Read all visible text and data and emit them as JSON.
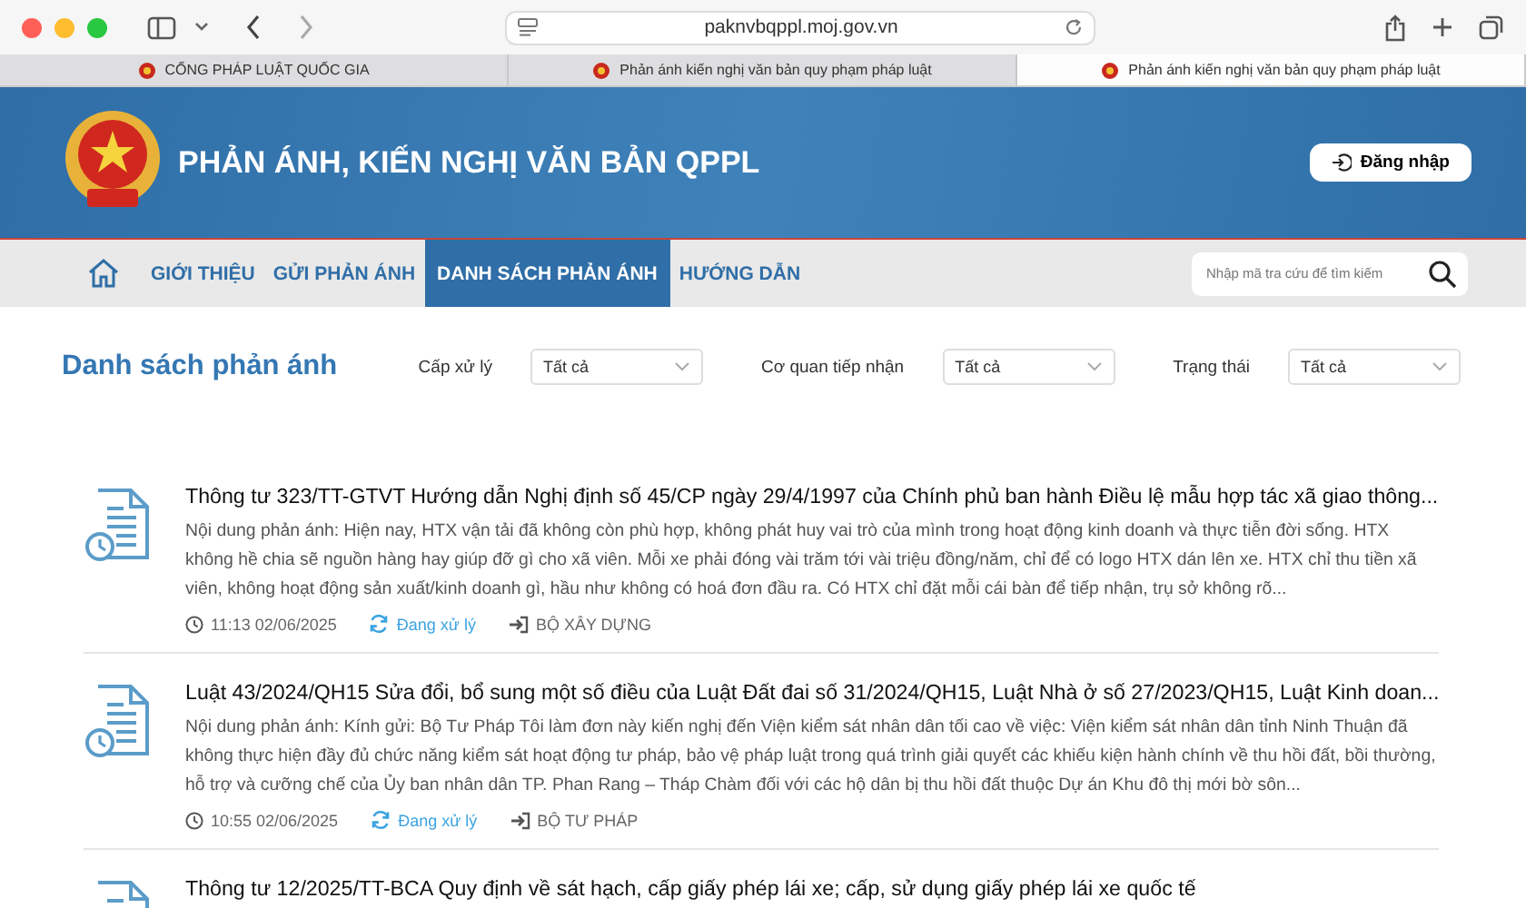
{
  "browser": {
    "url": "paknvbqppl.moj.gov.vn",
    "tabs": [
      {
        "title": "CỔNG PHÁP LUẬT QUỐC GIA",
        "selected": false
      },
      {
        "title": "Phản ánh kiến nghị văn bản quy phạm pháp luật",
        "selected": false
      },
      {
        "title": "Phản ánh kiến nghị văn bản quy phạm pháp luật",
        "selected": true
      }
    ]
  },
  "header": {
    "title": "PHẢN ÁNH, KIẾN NGHỊ VĂN BẢN QPPL",
    "login_button": "Đăng nhập"
  },
  "nav": {
    "items": [
      {
        "label": "GIỚI THIỆU",
        "selected": false
      },
      {
        "label": "GỬI PHẢN ÁNH",
        "selected": false
      },
      {
        "label": "DANH SÁCH PHẢN ÁNH",
        "selected": true
      },
      {
        "label": "HƯỚNG DẪN",
        "selected": false
      }
    ],
    "search": {
      "placeholder": "Nhập mã tra cứu để tìm kiếm"
    }
  },
  "page_title": "Danh sách phản ánh",
  "filters": [
    {
      "label": "Cấp xử lý",
      "value": "Tất cả"
    },
    {
      "label": "Cơ quan tiếp nhận",
      "value": "Tất cả"
    },
    {
      "label": "Trạng thái",
      "value": "Tất cả"
    }
  ],
  "items": [
    {
      "title": "Thông tư 323/TT-GTVT Hướng dẫn Nghị định số 45/CP ngày 29/4/1997 của Chính phủ ban hành Điều lệ mẫu hợp tác xã giao thông...",
      "content": "Nội dung phản ánh: Hiện nay, HTX vận tải đã không còn phù hợp, không phát huy vai trò của mình trong hoạt động kinh doanh và thực tiễn đời sống. HTX không hề chia sẽ nguồn hàng hay giúp đỡ gì cho xã viên. Mỗi xe phải đóng vài trăm tới vài triệu đồng/năm, chỉ để có logo HTX dán lên xe. HTX chỉ thu tiền xã viên, không hoạt động sản xuất/kinh doanh gì, hầu như không có hoá đơn đầu ra. Có HTX chỉ đặt mỗi cái bàn để tiếp nhận, trụ sở không rõ...",
      "time": "11:13 02/06/2025",
      "status": "Đang xử lý",
      "agency": "BỘ XÂY DỰNG"
    },
    {
      "title": "Luật 43/2024/QH15 Sửa đổi, bổ sung một số điều của Luật Đất đai số 31/2024/QH15, Luật Nhà ở số 27/2023/QH15, Luật Kinh doan...",
      "content": "Nội dung phản ánh: Kính gửi: Bộ Tư Pháp Tôi làm đơn này kiến nghị đến Viện kiểm sát nhân dân tối cao về việc: Viện kiểm sát nhân dân tỉnh Ninh Thuận đã không thực hiện đầy đủ chức năng kiểm sát hoạt động tư pháp, bảo vệ pháp luật trong quá trình giải quyết các khiếu kiện hành chính về thu hồi đất, bồi thường, hỗ trợ và cưỡng chế của Ủy ban nhân dân TP. Phan Rang – Tháp Chàm đối với các hộ dân bị thu hồi đất thuộc Dự án Khu đô thị mới bờ sôn...",
      "time": "10:55 02/06/2025",
      "status": "Đang xử lý",
      "agency": "BỘ TƯ PHÁP"
    },
    {
      "title": "Thông tư 12/2025/TT-BCA Quy định về sát hạch, cấp giấy phép lái xe; cấp, sử dụng giấy phép lái xe quốc tế"
    }
  ]
}
